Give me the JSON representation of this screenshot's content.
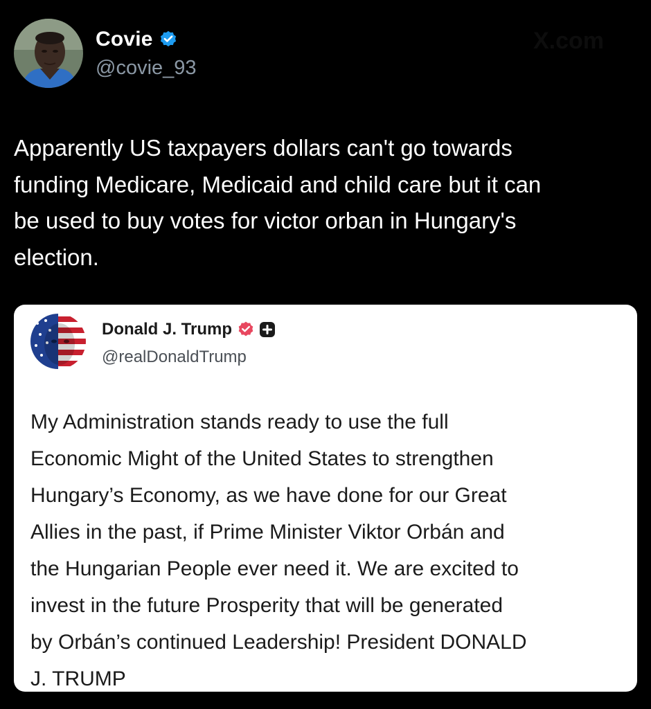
{
  "tweet": {
    "author": {
      "name": "Covie",
      "handle": "@covie_93",
      "verified": true,
      "avatar": "avatar-photo"
    },
    "watermark": "X.com",
    "text": "Apparently US taxpayers dollars can't go towards\nfunding Medicare, Medicaid and child care but it can\nbe used to buy votes for victor orban in Hungary's\nelection."
  },
  "quoted_post": {
    "author": {
      "name": "Donald J. Trump",
      "handle": "@realDonaldTrump",
      "verified": true,
      "avatar": "flag-face-avatar"
    },
    "text": "My Administration stands ready to use the full\nEconomic Might of the United States to strengthen\nHungary’s Economy, as we have done for our Great\nAllies in the past, if Prime Minister Viktor Orbán and\nthe Hungarian People ever need it. We are excited to\ninvest in the future Prosperity that will be generated\nby Orbán’s continued Leadership! President DONALD\nJ. TRUMP"
  },
  "colors": {
    "background": "#000000",
    "text_primary": "#ffffff",
    "handle_gray": "#8b98a5",
    "verified_blue": "#1d9bf0",
    "quote_badge_red": "#e8475f",
    "card_bg": "#ffffff"
  }
}
